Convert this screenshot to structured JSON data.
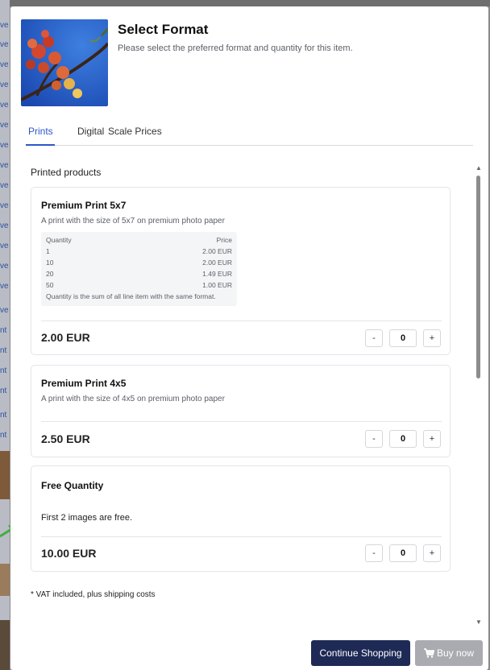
{
  "modal": {
    "title": "Select Format",
    "subtitle": "Please select the preferred format and quantity for this item."
  },
  "tabs": [
    {
      "label": "Prints",
      "active": true
    },
    {
      "label": "Digital",
      "active": false
    },
    {
      "label": "Scale Prices",
      "active": false
    }
  ],
  "section_label": "Printed products",
  "products": [
    {
      "title": "Premium Print 5x7",
      "description": "A print with the size of 5x7 on premium photo paper",
      "price_table": {
        "header": {
          "quantity": "Quantity",
          "price": "Price"
        },
        "rows": [
          {
            "quantity": "1",
            "price": "2.00 EUR"
          },
          {
            "quantity": "10",
            "price": "2.00 EUR"
          },
          {
            "quantity": "20",
            "price": "1.49 EUR"
          },
          {
            "quantity": "50",
            "price": "1.00 EUR"
          }
        ],
        "note": "Quantity is the sum of all line item with the same format."
      },
      "price": "2.00 EUR",
      "quantity": "0"
    },
    {
      "title": "Premium Print 4x5",
      "description": "A print with the size of 4x5 on premium photo paper",
      "price": "2.50 EUR",
      "quantity": "0"
    },
    {
      "title": "Free Quantity",
      "description": "First 2 images are free.",
      "price": "10.00 EUR",
      "quantity": "0"
    }
  ],
  "stepper": {
    "minus": "-",
    "plus": "+"
  },
  "vat_note": "* VAT included, plus shipping costs",
  "buttons": {
    "continue": "Continue Shopping",
    "buy": "Buy now"
  },
  "background_sidebar_text": [
    "ve",
    "ve",
    "ve",
    "ve",
    "ve",
    "ve",
    "ve",
    "ve",
    "ve",
    "ve",
    "ve",
    "ve",
    "ve",
    "ve",
    "ve",
    "nt",
    "nt",
    "nt",
    "nt",
    "nt",
    "nt"
  ],
  "icons": {
    "cart": "shopping-cart-icon",
    "scroll_up": "triangle-up-icon",
    "scroll_down": "triangle-down-icon",
    "arrow": "green-arrow-icon"
  },
  "colors": {
    "accent": "#2f56c8",
    "primary_button": "#1e2a55",
    "disabled_button": "#a9abb0",
    "arrow": "#3fae3c"
  }
}
